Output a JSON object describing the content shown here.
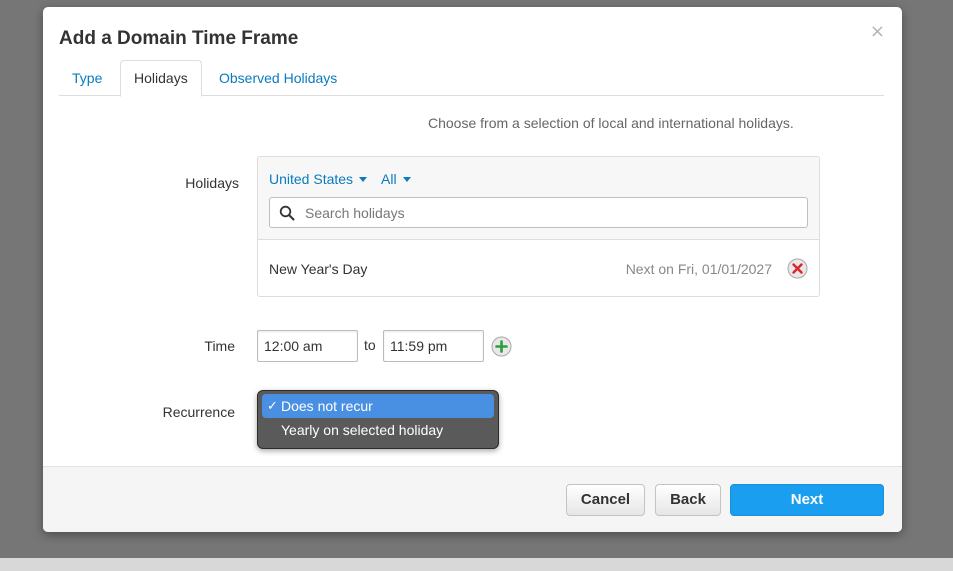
{
  "dialog": {
    "title": "Add a Domain Time Frame",
    "close_glyph": "×"
  },
  "tabs": [
    {
      "label": "Type",
      "active": false
    },
    {
      "label": "Holidays",
      "active": true
    },
    {
      "label": "Observed Holidays",
      "active": false
    }
  ],
  "intro": "Choose from a selection of local and international holidays.",
  "holidays": {
    "label": "Holidays",
    "country_filter": "United States",
    "type_filter": "All",
    "search_placeholder": "Search holidays",
    "items": [
      {
        "name": "New Year's Day",
        "next": "Next on Fri, 01/01/2027"
      }
    ]
  },
  "time": {
    "label": "Time",
    "start": "12:00 am",
    "separator": "to",
    "end": "11:59 pm"
  },
  "recurrence": {
    "label": "Recurrence",
    "options": [
      {
        "label": "Does not recur",
        "selected": true,
        "check": "✓"
      },
      {
        "label": "Yearly on selected holiday",
        "selected": false,
        "check": ""
      }
    ]
  },
  "buttons": {
    "cancel": "Cancel",
    "back": "Back",
    "next": "Next"
  },
  "colors": {
    "link": "#0a7bbd",
    "primary": "#1a9ff0",
    "remove": "#d9262b",
    "add": "#2e9e3a",
    "dropdown_selected": "#4a90e2"
  },
  "icons": {
    "search": "search-icon",
    "remove": "remove-circle-icon",
    "add": "add-circle-icon",
    "close": "close-icon",
    "check": "checkmark-icon"
  }
}
